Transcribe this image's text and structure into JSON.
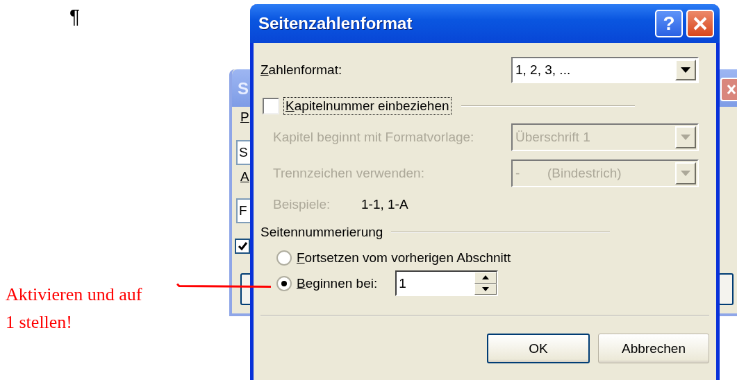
{
  "document": {
    "pilcrow": "¶"
  },
  "annotation": {
    "text": "Aktivieren und auf 1 stellen!"
  },
  "background_dialog": {
    "title": "S",
    "labels": [
      "P",
      "A"
    ],
    "fields": [
      "S",
      "F"
    ],
    "checkbox": {
      "checked": true
    }
  },
  "dialog": {
    "title": "Seitenzahlenformat",
    "help": "?",
    "number_format": {
      "label": "Zahlenformat:",
      "value": "1, 2, 3, ..."
    },
    "include_chapter": {
      "label": "Kapitelnummer einbeziehen",
      "checked": false,
      "focused": true
    },
    "chapter_style": {
      "label": "Kapitel beginnt mit Formatvorlage:",
      "value": "Überschrift 1",
      "disabled": true
    },
    "separator": {
      "label": "Trennzeichen verwenden:",
      "value": "-",
      "value_note": "(Bindestrich)",
      "disabled": true
    },
    "examples": {
      "label": "Beispiele:",
      "value": "1-1, 1-A",
      "disabled": true
    },
    "page_numbering": {
      "heading": "Seitennummerierung",
      "options": [
        {
          "label": "Fortsetzen vom vorherigen Abschnitt",
          "selected": false
        },
        {
          "label": "Beginnen bei:",
          "selected": true
        }
      ],
      "start_at": "1"
    },
    "buttons": [
      {
        "label": "OK",
        "default": true
      },
      {
        "label": "Abbrechen",
        "default": false
      }
    ]
  }
}
